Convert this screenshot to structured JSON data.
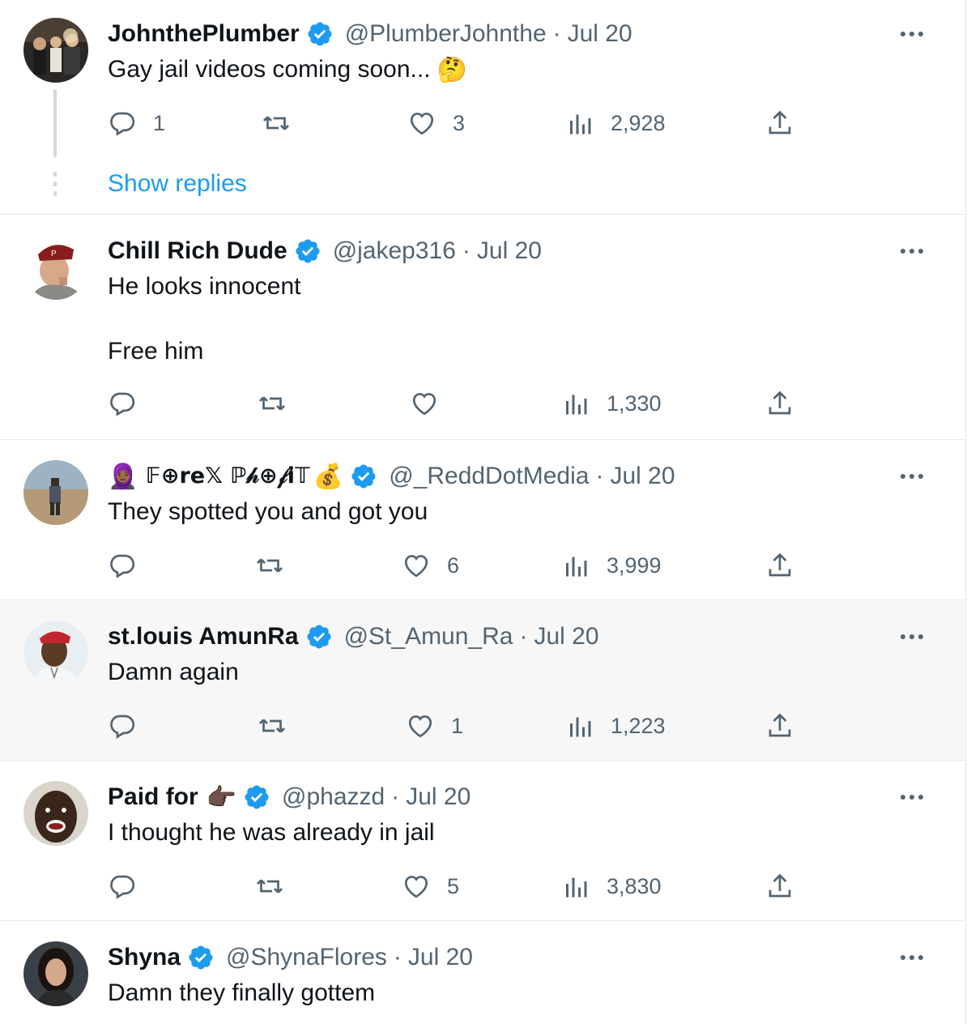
{
  "colors": {
    "verified": "#1d9bf0",
    "link": "#1d9bf0",
    "muted": "#536471",
    "text": "#0f1419"
  },
  "tweets": [
    {
      "name": "JohnthePlumber",
      "name_emoji": "",
      "handle": "@PlumberJohnthe",
      "separator": "·",
      "date": "Jul 20",
      "text": "Gay jail videos coming soon...",
      "text_emoji": "🤔",
      "replies": "1",
      "retweets": "",
      "likes": "3",
      "views": "2,928",
      "show_replies": "Show replies",
      "avatar_icon": "group-photo-avatar"
    },
    {
      "name": "Chill Rich Dude",
      "name_emoji": "",
      "handle": "@jakep316",
      "separator": "·",
      "date": "Jul 20",
      "text": "He looks innocent\n\nFree him",
      "text_emoji": "",
      "replies": "",
      "retweets": "",
      "likes": "",
      "views": "1,330",
      "avatar_icon": "man-with-cap-avatar"
    },
    {
      "name_prefix_emoji": "🧕🏾",
      "name": "𝔽⊕re𝕏 ℙ𝒽⊕𝒻i𝕋",
      "name_emoji": "💰",
      "handle": "@_ReddDotMedia",
      "separator": "·",
      "date": "Jul 20",
      "text": "They spotted you and got you",
      "text_emoji": "",
      "replies": "",
      "retweets": "",
      "likes": "6",
      "views": "3,999",
      "avatar_icon": "beach-person-avatar"
    },
    {
      "name": "st.louis AmunRa",
      "name_emoji": "",
      "handle": "@St_Amun_Ra",
      "separator": "·",
      "date": "Jul 20",
      "text": "Damn again",
      "text_emoji": "",
      "replies": "",
      "retweets": "",
      "likes": "1",
      "views": "1,223",
      "avatar_icon": "man-red-cap-avatar"
    },
    {
      "name": "Paid for",
      "name_emoji": "👉🏿",
      "handle": "@phazzd",
      "separator": "·",
      "date": "Jul 20",
      "text": "I thought he was already in jail",
      "text_emoji": "",
      "replies": "",
      "retweets": "",
      "likes": "5",
      "views": "3,830",
      "avatar_icon": "man-selfie-avatar"
    },
    {
      "name": "Shyna",
      "name_emoji": "",
      "handle": "@ShynaFlores",
      "separator": "·",
      "date": "Jul 20",
      "text": "Damn they finally gottem",
      "text_emoji": "",
      "avatar_icon": "woman-avatar"
    }
  ]
}
